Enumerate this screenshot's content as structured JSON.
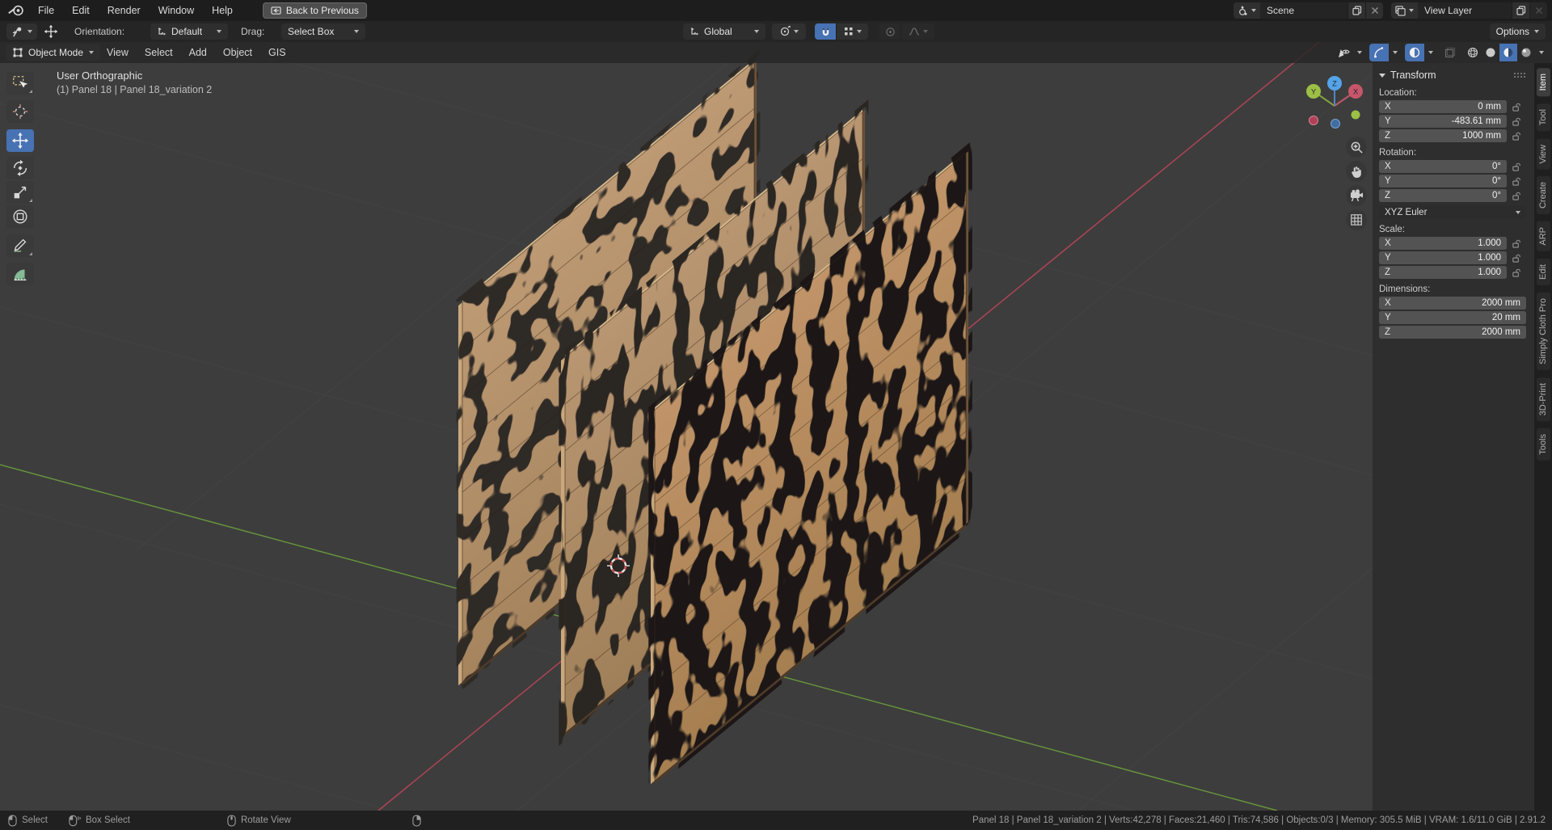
{
  "topbar": {
    "menus": [
      "File",
      "Edit",
      "Render",
      "Window",
      "Help"
    ],
    "back_button": "Back to Previous",
    "scene": {
      "value": "Scene"
    },
    "view_layer": {
      "value": "View Layer"
    }
  },
  "tool_settings": {
    "orientation_label": "Orientation:",
    "orientation_value": "Default",
    "drag_label": "Drag:",
    "drag_value": "Select Box",
    "transform_orientation": "Global",
    "options_label": "Options"
  },
  "viewport_header": {
    "mode": "Object Mode",
    "menus": [
      "View",
      "Select",
      "Add",
      "Object",
      "GIS"
    ]
  },
  "toolbar": {
    "tools": [
      "tweak-select",
      "cursor",
      "move",
      "rotate",
      "scale",
      "transform",
      "annotate",
      "measure"
    ],
    "active_tool": "move"
  },
  "viewport": {
    "view_label": "User Orthographic",
    "selection_label": "(1) Panel 18 | Panel 18_variation 2",
    "gizmo": {
      "x": "X",
      "y": "Y",
      "z": "Z"
    }
  },
  "sidebar": {
    "tabs": [
      "Item",
      "Tool",
      "View",
      "Create",
      "ARP",
      "Edit",
      "Simply Cloth Pro",
      "3D-Print",
      "Tools"
    ],
    "active_tab": "Item",
    "transform": {
      "title": "Transform",
      "location_label": "Location:",
      "rotation_label": "Rotation:",
      "scale_label": "Scale:",
      "dimensions_label": "Dimensions:",
      "rotation_mode": "XYZ Euler",
      "axis_x": "X",
      "axis_y": "Y",
      "axis_z": "Z",
      "location": {
        "x": "0 mm",
        "y": "-483.61 mm",
        "z": "1000 mm"
      },
      "rotation": {
        "x": "0°",
        "y": "0°",
        "z": "0°"
      },
      "scale": {
        "x": "1.000",
        "y": "1.000",
        "z": "1.000"
      },
      "dimensions": {
        "x": "2000 mm",
        "y": "20 mm",
        "z": "2000 mm"
      }
    }
  },
  "statusbar": {
    "hints": [
      "Select",
      "Box Select",
      "Rotate View"
    ],
    "stats": "Panel 18 | Panel 18_variation 2 | Verts:42,278 | Faces:21,460 | Tris:74,586 | Objects:0/3 | Memory: 305.5 MiB | VRAM: 1.6/11.0 GiB | 2.91.2"
  },
  "colors": {
    "accent": "#4772b3",
    "wood": "#b1906a",
    "axis_x": "#b04455",
    "axis_y": "#66923c"
  }
}
